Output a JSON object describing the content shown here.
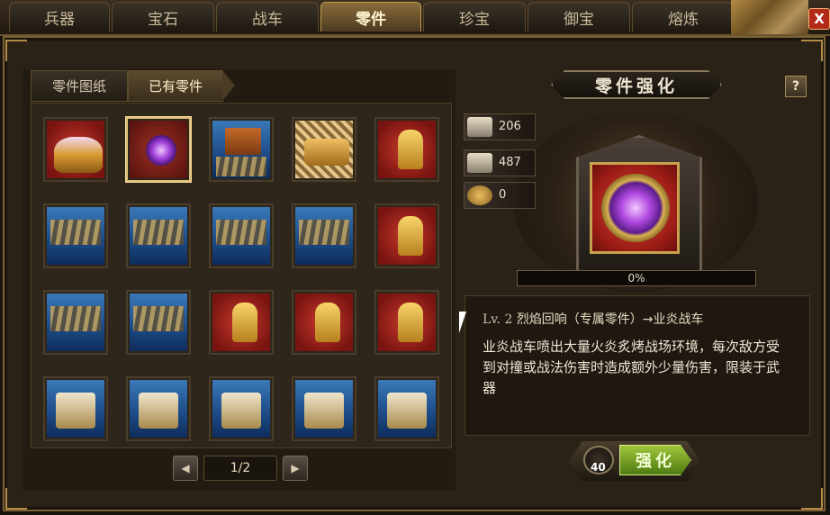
{
  "top_tabs": [
    {
      "label": "兵器",
      "active": false
    },
    {
      "label": "宝石",
      "active": false
    },
    {
      "label": "战车",
      "active": false
    },
    {
      "label": "零件",
      "active": true
    },
    {
      "label": "珍宝",
      "active": false
    },
    {
      "label": "御宝",
      "active": false
    },
    {
      "label": "熔炼",
      "active": false
    }
  ],
  "close_label": "X",
  "sub_tabs": [
    {
      "label": "零件图纸",
      "active": false
    },
    {
      "label": "已有零件",
      "active": true
    }
  ],
  "parts_grid": {
    "rows": 4,
    "columns": 5,
    "selected_index": 1,
    "items": [
      {
        "kind": "golden-beast-red-bg"
      },
      {
        "kind": "purple-vortex-orb"
      },
      {
        "kind": "war-banner-blue-bg"
      },
      {
        "kind": "golden-net"
      },
      {
        "kind": "golden-general-red-bg"
      },
      {
        "kind": "troops-blue-bg"
      },
      {
        "kind": "troops-blue-bg"
      },
      {
        "kind": "troops-blue-bg"
      },
      {
        "kind": "troops-blue-bg"
      },
      {
        "kind": "golden-general-red-bg"
      },
      {
        "kind": "troops-blue-bg"
      },
      {
        "kind": "troops-blue-bg"
      },
      {
        "kind": "golden-general-red-bg"
      },
      {
        "kind": "golden-general-red-bg"
      },
      {
        "kind": "golden-general-red-bg"
      },
      {
        "kind": "war-cart-blue-bg"
      },
      {
        "kind": "war-cart-blue-bg"
      },
      {
        "kind": "war-cart-blue-bg"
      },
      {
        "kind": "war-cart-blue-bg"
      },
      {
        "kind": "war-cart-blue-bg"
      }
    ]
  },
  "pager": {
    "prev_icon": "triangle-left-icon",
    "next_icon": "triangle-right-icon",
    "text": "1/2"
  },
  "panel": {
    "title": "零件强化",
    "help_label": "?",
    "resources": [
      {
        "icon": "scroll-icon",
        "value": "206"
      },
      {
        "icon": "blueprint-icon",
        "value": "487"
      },
      {
        "icon": "coin-pile-icon",
        "value": "0"
      }
    ],
    "progress": {
      "percent": 0,
      "label": "0%"
    },
    "item": {
      "level": "Lv. 2",
      "name": "烈焰回响（专属零件）→业炎战车",
      "description": "业炎战车喷出大量火炎炙烤战场环境，每次敌方受到对撞或战法伤害时造成额外少量伤害，限装于武器"
    },
    "enhance": {
      "cost": "40",
      "label": "强化"
    }
  },
  "colors": {
    "accent_gold": "#c49a4e",
    "enhance_green": "#7aa82a",
    "selected_border": "#e2c17a"
  }
}
